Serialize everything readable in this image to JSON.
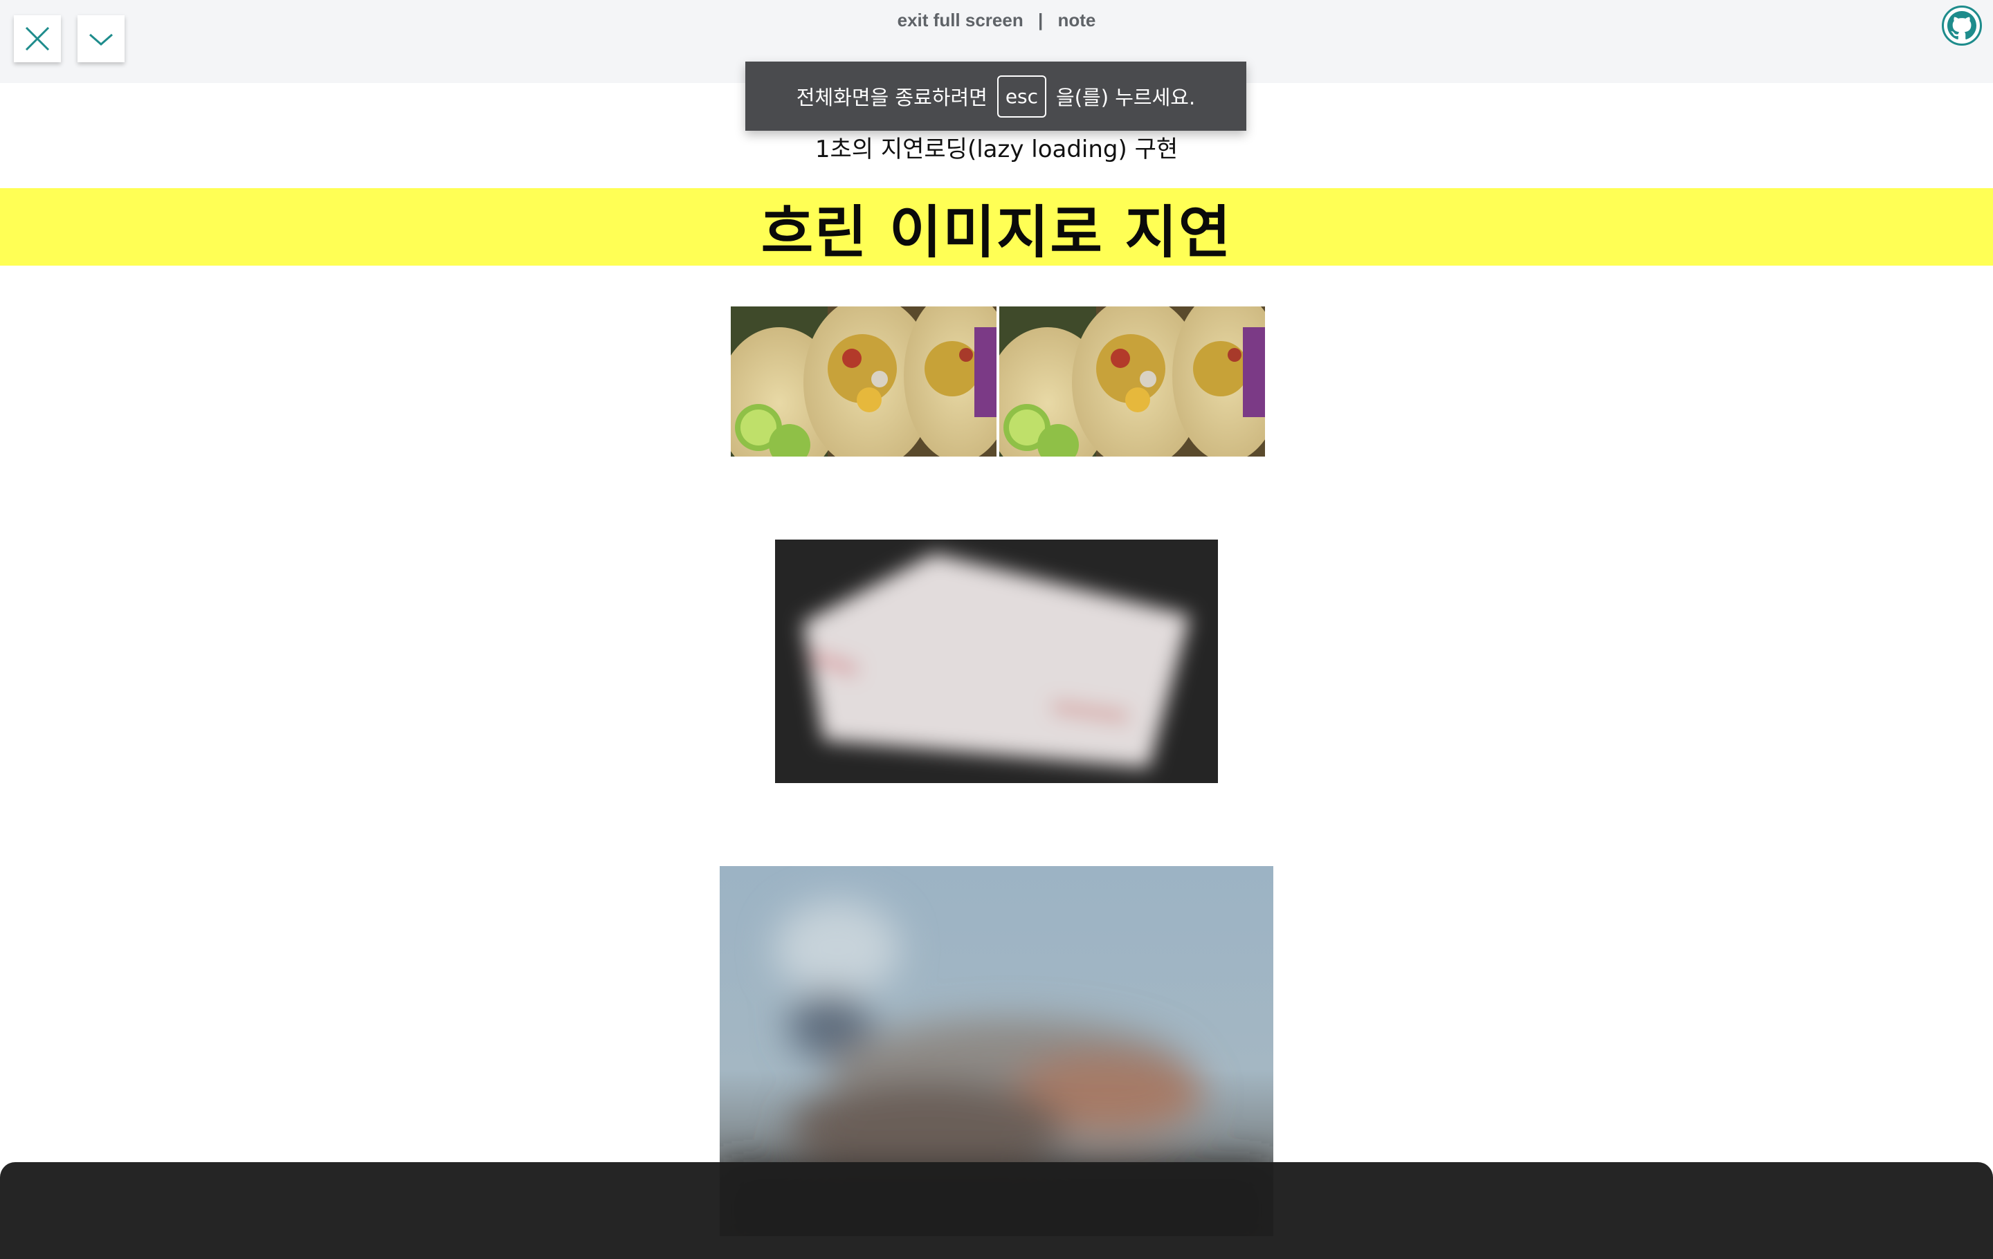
{
  "topbar": {
    "exit_label": "exit full screen",
    "separator": "|",
    "note_label": "note"
  },
  "toast": {
    "before_key": "전체화면을 종료하려면",
    "key": "esc",
    "after_key": "을(를) 누르세요."
  },
  "page": {
    "subtitle": "1초의 지연로딩(lazy loading) 구현",
    "banner_title": "흐린 이미지로 지연"
  },
  "colors": {
    "banner": "#ffff55",
    "accent": "#1e8c8c",
    "toast_bg": "#4a4b4e"
  },
  "icons": {
    "close": "close-icon",
    "chevron": "chevron-down-icon",
    "github": "github-icon"
  }
}
